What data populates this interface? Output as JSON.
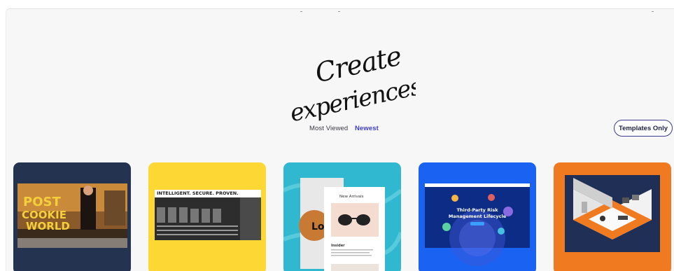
{
  "hero": {
    "line1": "Create",
    "line2": "experiences"
  },
  "sort_tabs": [
    {
      "label": "Most Viewed",
      "active": false
    },
    {
      "label": "Newest",
      "active": true
    }
  ],
  "filter": {
    "label": "Templates Only"
  },
  "colors": {
    "accent": "#3c3cd6",
    "button_border": "#3a3a8e"
  },
  "cards": [
    {
      "bg": "#24334f",
      "poster_lines": [
        "POST",
        "COOKIE",
        "WORLD"
      ]
    },
    {
      "bg": "#fdd835",
      "header": "INTELLIGENT. SECURE. PROVEN."
    },
    {
      "bg": "#2fb8cf",
      "panel_title": "New Arrivals",
      "big_text": "Lou",
      "caption": "Insider"
    },
    {
      "bg": "#1a63f2",
      "title_lines": [
        "Third-Party Risk",
        "Management Lifecycle"
      ]
    },
    {
      "bg": "#f07a1f"
    }
  ]
}
